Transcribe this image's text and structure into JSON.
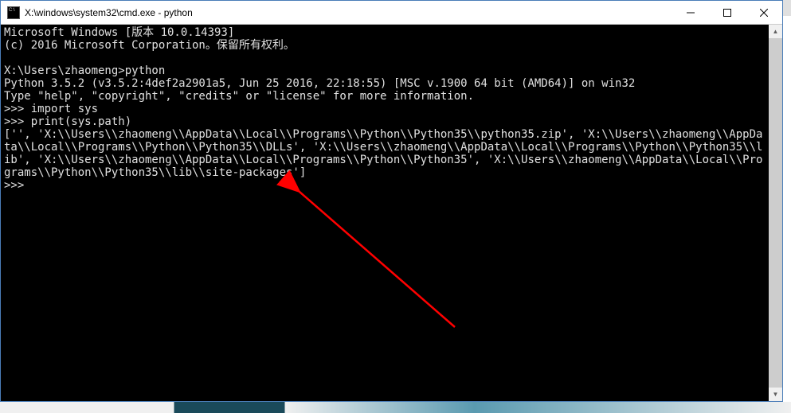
{
  "titlebar": {
    "title": "X:\\windows\\system32\\cmd.exe - python"
  },
  "terminal": {
    "line1": "Microsoft Windows [版本 10.0.14393]",
    "line2": "(c) 2016 Microsoft Corporation。保留所有权利。",
    "blank1": "",
    "line3": "X:\\Users\\zhaomeng>python",
    "line4": "Python 3.5.2 (v3.5.2:4def2a2901a5, Jun 25 2016, 22:18:55) [MSC v.1900 64 bit (AMD64)] on win32",
    "line5": "Type \"help\", \"copyright\", \"credits\" or \"license\" for more information.",
    "line6": ">>> import sys",
    "line7": ">>> print(sys.path)",
    "line8": "['', 'X:\\\\Users\\\\zhaomeng\\\\AppData\\\\Local\\\\Programs\\\\Python\\\\Python35\\\\python35.zip', 'X:\\\\Users\\\\zhaomeng\\\\AppData\\\\Local\\\\Programs\\\\Python\\\\Python35\\\\DLLs', 'X:\\\\Users\\\\zhaomeng\\\\AppData\\\\Local\\\\Programs\\\\Python\\\\Python35\\\\lib', 'X:\\\\Users\\\\zhaomeng\\\\AppData\\\\Local\\\\Programs\\\\Python\\\\Python35', 'X:\\\\Users\\\\zhaomeng\\\\AppData\\\\Local\\\\Programs\\\\Python\\\\Python35\\\\lib\\\\site-packages']",
    "line9": ">>> "
  }
}
